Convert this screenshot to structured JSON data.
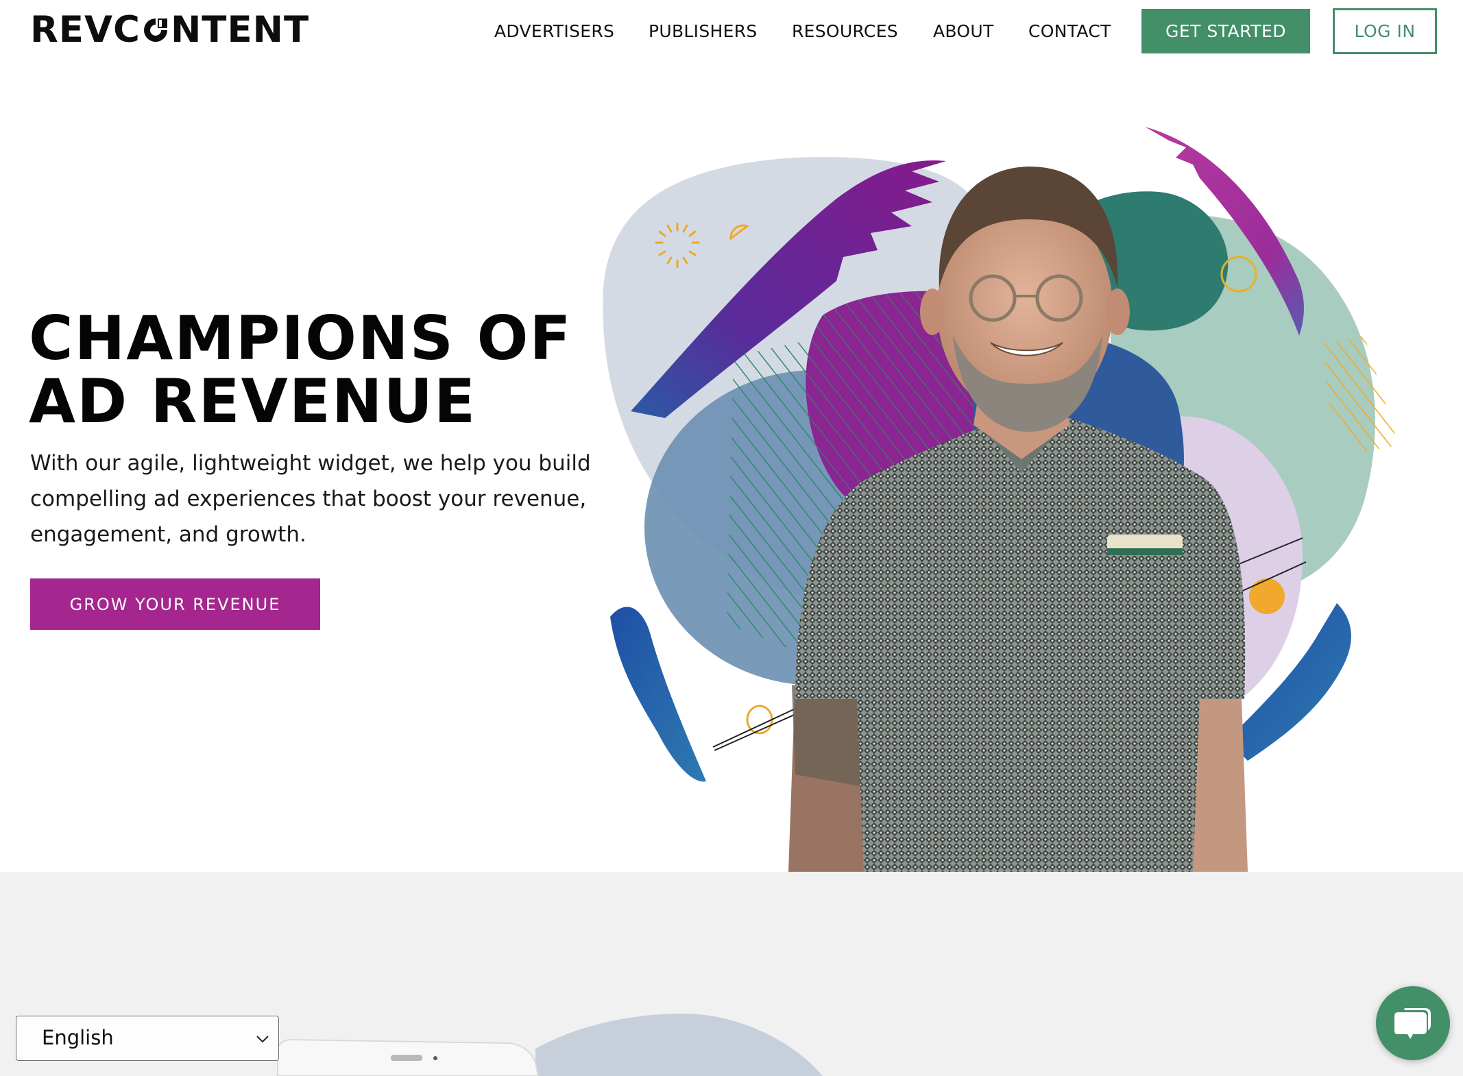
{
  "brand": {
    "logo_text_before": "REVC",
    "logo_text_after": "NTENT",
    "logo_alt": "REVCONTENT",
    "primary_green": "#438f68",
    "accent_purple": "#a4268e"
  },
  "nav": {
    "items": [
      {
        "label": "ADVERTISERS"
      },
      {
        "label": "PUBLISHERS"
      },
      {
        "label": "RESOURCES"
      },
      {
        "label": "ABOUT"
      },
      {
        "label": "CONTACT"
      }
    ],
    "get_started_label": "GET STARTED",
    "login_label": "LOG IN"
  },
  "hero": {
    "title_line1": "CHAMPIONS OF",
    "title_line2": "AD REVENUE",
    "description": "With our agile, lightweight widget, we help you build compelling ad experiences that boost your revenue, engagement, and growth.",
    "cta_label": "GROW YOUR REVENUE",
    "image_alt": "Smiling man with glasses and beard in patterned shirt over colorful abstract shapes"
  },
  "language_selector": {
    "selected": "English"
  },
  "chat": {
    "icon": "chat-bubbles-icon"
  }
}
